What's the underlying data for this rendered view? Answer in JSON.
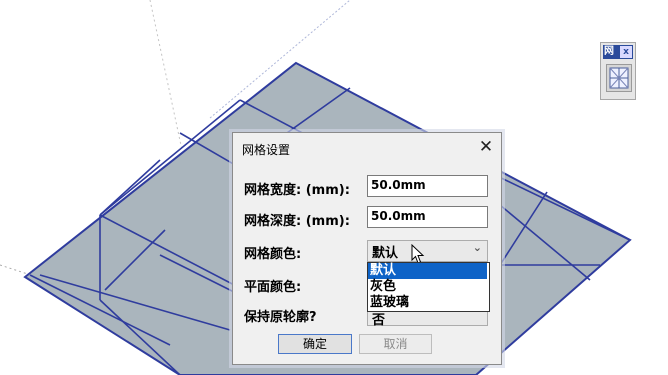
{
  "dialog": {
    "title": "网格设置",
    "close_glyph": "✕",
    "grid_width": {
      "label": "网格宽度:  (mm):",
      "value": "50.0mm"
    },
    "grid_depth": {
      "label": "网格深度:  (mm):",
      "value": "50.0mm"
    },
    "grid_color": {
      "label": "网格颜色:",
      "value": "默认",
      "options": [
        "默认",
        "灰色",
        "蓝玻璃"
      ]
    },
    "plane_color": {
      "label": "平面颜色:"
    },
    "keep_outline": {
      "label": "保持原轮廓?",
      "value": "否"
    },
    "ok_label": "确定",
    "cancel_label": "取消"
  },
  "toolbar": {
    "title": "网",
    "close": "x"
  },
  "colors": {
    "plane_fill": "#aab5bd",
    "grid_lines": "#2f3c9e",
    "dialog_bg": "#f0f0f0",
    "selection": "#0e63c7"
  }
}
